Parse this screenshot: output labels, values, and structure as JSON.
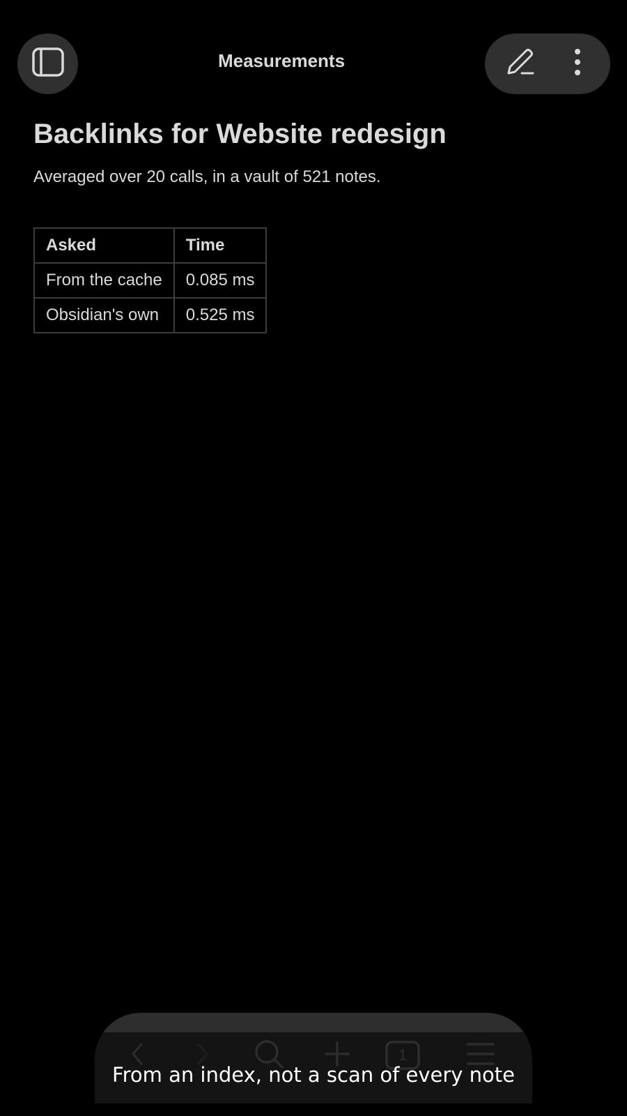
{
  "app": {
    "title": "Measurements"
  },
  "header": {
    "left_button_icon": "sidebar-toggle-icon",
    "right_buttons": [
      "edit-pencil-icon",
      "more-vertical-icon"
    ]
  },
  "note": {
    "title": "Backlinks for Website redesign",
    "intro": "Averaged over 20 calls, in a vault of 521 notes.",
    "table": {
      "headers": [
        "Asked",
        "Time"
      ],
      "rows": [
        [
          "From the cache",
          "0.085 ms"
        ],
        [
          "Obsidian's own",
          "0.525 ms"
        ]
      ]
    }
  },
  "bottom_nav": {
    "items": [
      "back-icon",
      "forward-icon",
      "search-icon",
      "add-icon",
      "tabs-icon",
      "menu-icon"
    ],
    "tab_count": "1"
  },
  "caption": "From an index, not a scan of every note",
  "colors": {
    "background": "#000000",
    "surface": "#303030",
    "text": "#dadada",
    "table_border": "#3c3c3c",
    "caption": "#ffffff"
  }
}
